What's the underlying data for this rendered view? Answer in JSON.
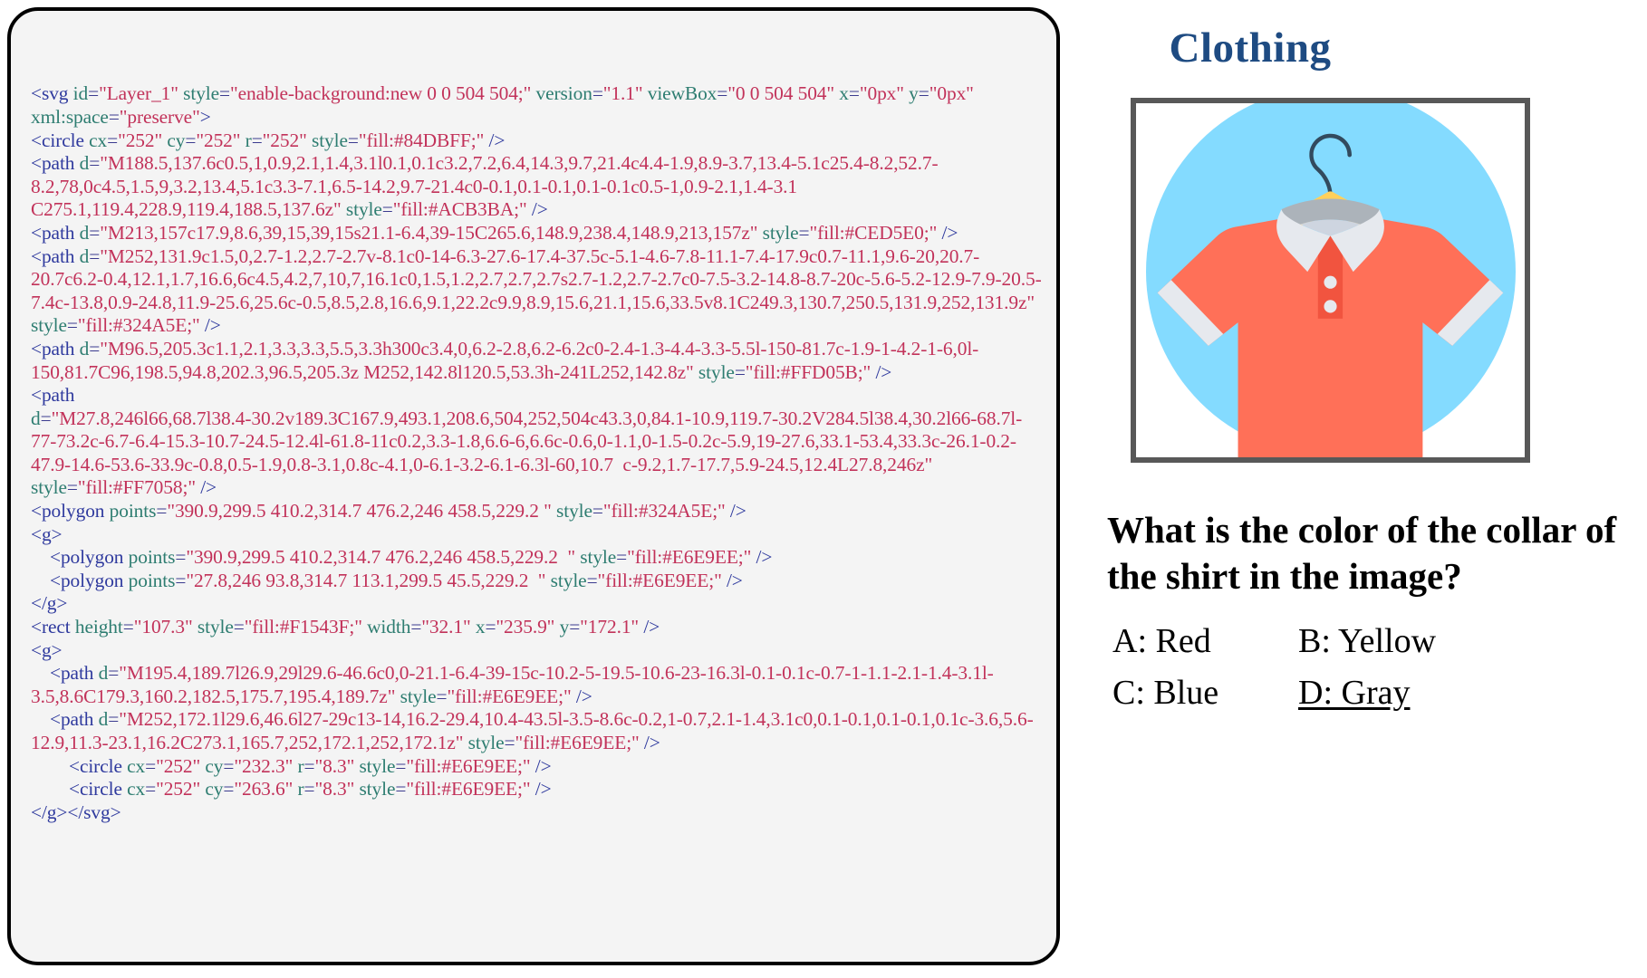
{
  "code_panel": {
    "language": "svg-xml",
    "lines": [
      [
        {
          "t": "tag",
          "v": "<svg "
        },
        {
          "t": "attr",
          "v": "id"
        },
        {
          "t": "eq",
          "v": "="
        },
        {
          "t": "val",
          "v": "\"Layer_1\""
        },
        {
          "t": "plain",
          "v": " "
        },
        {
          "t": "attr",
          "v": "style"
        },
        {
          "t": "eq",
          "v": "="
        },
        {
          "t": "val",
          "v": "\"enable-background:new 0 0 504 504;\""
        },
        {
          "t": "plain",
          "v": " "
        },
        {
          "t": "attr",
          "v": "version"
        },
        {
          "t": "eq",
          "v": "="
        },
        {
          "t": "val",
          "v": "\"1.1\""
        },
        {
          "t": "plain",
          "v": " "
        },
        {
          "t": "attr",
          "v": "viewBox"
        },
        {
          "t": "eq",
          "v": "="
        },
        {
          "t": "val",
          "v": "\"0 0 504 504\""
        },
        {
          "t": "plain",
          "v": " "
        },
        {
          "t": "attr",
          "v": "x"
        },
        {
          "t": "eq",
          "v": "="
        },
        {
          "t": "val",
          "v": "\"0px\""
        },
        {
          "t": "plain",
          "v": " "
        },
        {
          "t": "attr",
          "v": "y"
        },
        {
          "t": "eq",
          "v": "="
        },
        {
          "t": "val",
          "v": "\"0px\""
        },
        {
          "t": "plain",
          "v": " "
        },
        {
          "t": "attr",
          "v": "xml:space"
        },
        {
          "t": "eq",
          "v": "="
        },
        {
          "t": "val",
          "v": "\"preserve\""
        },
        {
          "t": "tag",
          "v": ">"
        }
      ],
      [
        {
          "t": "tag",
          "v": "<circle "
        },
        {
          "t": "attr",
          "v": "cx"
        },
        {
          "t": "eq",
          "v": "="
        },
        {
          "t": "val",
          "v": "\"252\""
        },
        {
          "t": "plain",
          "v": " "
        },
        {
          "t": "attr",
          "v": "cy"
        },
        {
          "t": "eq",
          "v": "="
        },
        {
          "t": "val",
          "v": "\"252\""
        },
        {
          "t": "plain",
          "v": " "
        },
        {
          "t": "attr",
          "v": "r"
        },
        {
          "t": "eq",
          "v": "="
        },
        {
          "t": "val",
          "v": "\"252\""
        },
        {
          "t": "plain",
          "v": " "
        },
        {
          "t": "attr",
          "v": "style"
        },
        {
          "t": "eq",
          "v": "="
        },
        {
          "t": "val",
          "v": "\"fill:#84DBFF;\""
        },
        {
          "t": "plain",
          "v": " "
        },
        {
          "t": "slash",
          "v": "/>"
        }
      ],
      [
        {
          "t": "tag",
          "v": "<path "
        },
        {
          "t": "attr",
          "v": "d"
        },
        {
          "t": "eq",
          "v": "="
        },
        {
          "t": "val",
          "v": "\"M188.5,137.6c0.5,1,0.9,2.1,1.4,3.1l0.1,0.1c3.2,7.2,6.4,14.3,9.7,21.4c4.4-1.9,8.9-3.7,13.4-5.1c25.4-8.2,52.7-8.2,78,0c4.5,1.5,9,3.2,13.4,5.1c3.3-7.1,6.5-14.2,9.7-21.4c0-0.1,0.1-0.1,0.1-0.1c0.5-1,0.9-2.1,1.4-3.1  C275.1,119.4,228.9,119.4,188.5,137.6z\""
        },
        {
          "t": "plain",
          "v": " "
        },
        {
          "t": "attr",
          "v": "style"
        },
        {
          "t": "eq",
          "v": "="
        },
        {
          "t": "val",
          "v": "\"fill:#ACB3BA;\""
        },
        {
          "t": "plain",
          "v": " "
        },
        {
          "t": "slash",
          "v": "/>"
        }
      ],
      [
        {
          "t": "tag",
          "v": "<path "
        },
        {
          "t": "attr",
          "v": "d"
        },
        {
          "t": "eq",
          "v": "="
        },
        {
          "t": "val",
          "v": "\"M213,157c17.9,8.6,39,15,39,15s21.1-6.4,39-15C265.6,148.9,238.4,148.9,213,157z\""
        },
        {
          "t": "plain",
          "v": " "
        },
        {
          "t": "attr",
          "v": "style"
        },
        {
          "t": "eq",
          "v": "="
        },
        {
          "t": "val",
          "v": "\"fill:#CED5E0;\""
        },
        {
          "t": "plain",
          "v": " "
        },
        {
          "t": "slash",
          "v": "/>"
        }
      ],
      [
        {
          "t": "tag",
          "v": "<path "
        },
        {
          "t": "attr",
          "v": "d"
        },
        {
          "t": "eq",
          "v": "="
        },
        {
          "t": "val",
          "v": "\"M252,131.9c1.5,0,2.7-1.2,2.7-2.7v-8.1c0-14-6.3-27.6-17.4-37.5c-5.1-4.6-7.8-11.1-7.4-17.9c0.7-11.1,9.6-20,20.7-20.7c6.2-0.4,12.1,1.7,16.6,6c4.5,4.2,7,10,7,16.1c0,1.5,1.2,2.7,2.7,2.7s2.7-1.2,2.7-2.7c0-7.5-3.2-14.8-8.7-20c-5.6-5.2-12.9-7.9-20.5-7.4c-13.8,0.9-24.8,11.9-25.6,25.6c-0.5,8.5,2.8,16.6,9.1,22.2c9.9,8.9,15.6,21.1,15.6,33.5v8.1C249.3,130.7,250.5,131.9,252,131.9z\""
        },
        {
          "t": "plain",
          "v": " "
        },
        {
          "t": "attr",
          "v": "style"
        },
        {
          "t": "eq",
          "v": "="
        },
        {
          "t": "val",
          "v": "\"fill:#324A5E;\""
        },
        {
          "t": "plain",
          "v": " "
        },
        {
          "t": "slash",
          "v": "/>"
        }
      ],
      [
        {
          "t": "tag",
          "v": "<path "
        },
        {
          "t": "attr",
          "v": "d"
        },
        {
          "t": "eq",
          "v": "="
        },
        {
          "t": "val",
          "v": "\"M96.5,205.3c1.1,2.1,3.3,3.3,5.5,3.3h300c3.4,0,6.2-2.8,6.2-6.2c0-2.4-1.3-4.4-3.3-5.5l-150-81.7c-1.9-1-4.2-1-6,0l-150,81.7C96,198.5,94.8,202.3,96.5,205.3z M252,142.8l120.5,53.3h-241L252,142.8z\""
        },
        {
          "t": "plain",
          "v": " "
        },
        {
          "t": "attr",
          "v": "style"
        },
        {
          "t": "eq",
          "v": "="
        },
        {
          "t": "val",
          "v": "\"fill:#FFD05B;\""
        },
        {
          "t": "plain",
          "v": " "
        },
        {
          "t": "slash",
          "v": "/>"
        }
      ],
      [
        {
          "t": "tag",
          "v": "<path"
        }
      ],
      [
        {
          "t": "attr",
          "v": "d"
        },
        {
          "t": "eq",
          "v": "="
        },
        {
          "t": "val",
          "v": "\"M27.8,246l66,68.7l38.4-30.2v189.3C167.9,493.1,208.6,504,252,504c43.3,0,84.1-10.9,119.7-30.2V284.5l38.4,30.2l66-68.7l-77-73.2c-6.7-6.4-15.3-10.7-24.5-12.4l-61.8-11c0.2,3.3-1.8,6.6-6,6.6c-0.6,0-1.1,0-1.5-0.2c-5.9,19-27.6,33.1-53.4,33.3c-26.1-0.2-47.9-14.6-53.6-33.9c-0.8,0.5-1.9,0.8-3.1,0.8c-4.1,0-6.1-3.2-6.1-6.3l-60,10.7  c-9.2,1.7-17.7,5.9-24.5,12.4L27.8,246z\""
        },
        {
          "t": "plain",
          "v": " "
        },
        {
          "t": "attr",
          "v": "style"
        },
        {
          "t": "eq",
          "v": "="
        },
        {
          "t": "val",
          "v": "\"fill:#FF7058;\""
        },
        {
          "t": "plain",
          "v": " "
        },
        {
          "t": "slash",
          "v": "/>"
        }
      ],
      [
        {
          "t": "tag",
          "v": "<polygon "
        },
        {
          "t": "attr",
          "v": "points"
        },
        {
          "t": "eq",
          "v": "="
        },
        {
          "t": "val",
          "v": "\"390.9,299.5 410.2,314.7 476.2,246 458.5,229.2 \""
        },
        {
          "t": "plain",
          "v": " "
        },
        {
          "t": "attr",
          "v": "style"
        },
        {
          "t": "eq",
          "v": "="
        },
        {
          "t": "val",
          "v": "\"fill:#324A5E;\""
        },
        {
          "t": "plain",
          "v": " "
        },
        {
          "t": "slash",
          "v": "/>"
        }
      ],
      [
        {
          "t": "tag",
          "v": "<g>"
        }
      ],
      [
        {
          "t": "indent",
          "v": "    "
        },
        {
          "t": "tag",
          "v": "<polygon "
        },
        {
          "t": "attr",
          "v": "points"
        },
        {
          "t": "eq",
          "v": "="
        },
        {
          "t": "val",
          "v": "\"390.9,299.5 410.2,314.7 476.2,246 458.5,229.2  \""
        },
        {
          "t": "plain",
          "v": " "
        },
        {
          "t": "attr",
          "v": "style"
        },
        {
          "t": "eq",
          "v": "="
        },
        {
          "t": "val",
          "v": "\"fill:#E6E9EE;\""
        },
        {
          "t": "plain",
          "v": " "
        },
        {
          "t": "slash",
          "v": "/>"
        }
      ],
      [
        {
          "t": "indent",
          "v": "    "
        },
        {
          "t": "tag",
          "v": "<polygon "
        },
        {
          "t": "attr",
          "v": "points"
        },
        {
          "t": "eq",
          "v": "="
        },
        {
          "t": "val",
          "v": "\"27.8,246 93.8,314.7 113.1,299.5 45.5,229.2  \""
        },
        {
          "t": "plain",
          "v": " "
        },
        {
          "t": "attr",
          "v": "style"
        },
        {
          "t": "eq",
          "v": "="
        },
        {
          "t": "val",
          "v": "\"fill:#E6E9EE;\""
        },
        {
          "t": "plain",
          "v": " "
        },
        {
          "t": "slash",
          "v": "/>"
        }
      ],
      [
        {
          "t": "tag",
          "v": "</g>"
        }
      ],
      [
        {
          "t": "tag",
          "v": "<rect "
        },
        {
          "t": "attr",
          "v": "height"
        },
        {
          "t": "eq",
          "v": "="
        },
        {
          "t": "val",
          "v": "\"107.3\""
        },
        {
          "t": "plain",
          "v": " "
        },
        {
          "t": "attr",
          "v": "style"
        },
        {
          "t": "eq",
          "v": "="
        },
        {
          "t": "val",
          "v": "\"fill:#F1543F;\""
        },
        {
          "t": "plain",
          "v": " "
        },
        {
          "t": "attr",
          "v": "width"
        },
        {
          "t": "eq",
          "v": "="
        },
        {
          "t": "val",
          "v": "\"32.1\""
        },
        {
          "t": "plain",
          "v": " "
        },
        {
          "t": "attr",
          "v": "x"
        },
        {
          "t": "eq",
          "v": "="
        },
        {
          "t": "val",
          "v": "\"235.9\""
        },
        {
          "t": "plain",
          "v": " "
        },
        {
          "t": "attr",
          "v": "y"
        },
        {
          "t": "eq",
          "v": "="
        },
        {
          "t": "val",
          "v": "\"172.1\""
        },
        {
          "t": "plain",
          "v": " "
        },
        {
          "t": "slash",
          "v": "/>"
        }
      ],
      [
        {
          "t": "tag",
          "v": "<g>"
        }
      ],
      [
        {
          "t": "indent",
          "v": "    "
        },
        {
          "t": "tag",
          "v": "<path "
        },
        {
          "t": "attr",
          "v": "d"
        },
        {
          "t": "eq",
          "v": "="
        },
        {
          "t": "val",
          "v": "\"M195.4,189.7l26.9,29l29.6-46.6c0,0-21.1-6.4-39-15c-10.2-5-19.5-10.6-23-16.3l-0.1-0.1c-0.7-1-1.1-2.1-1.4-3.1l-3.5,8.6C179.3,160.2,182.5,175.7,195.4,189.7z\""
        },
        {
          "t": "plain",
          "v": " "
        },
        {
          "t": "attr",
          "v": "style"
        },
        {
          "t": "eq",
          "v": "="
        },
        {
          "t": "val",
          "v": "\"fill:#E6E9EE;\""
        },
        {
          "t": "plain",
          "v": " "
        },
        {
          "t": "slash",
          "v": "/>"
        }
      ],
      [
        {
          "t": "indent",
          "v": "    "
        },
        {
          "t": "tag",
          "v": "<path "
        },
        {
          "t": "attr",
          "v": "d"
        },
        {
          "t": "eq",
          "v": "="
        },
        {
          "t": "val",
          "v": "\"M252,172.1l29.6,46.6l27-29c13-14,16.2-29.4,10.4-43.5l-3.5-8.6c-0.2,1-0.7,2.1-1.4,3.1c0,0.1-0.1,0.1-0.1,0.1c-3.6,5.6-12.9,11.3-23.1,16.2C273.1,165.7,252,172.1,252,172.1z\""
        },
        {
          "t": "plain",
          "v": " "
        },
        {
          "t": "attr",
          "v": "style"
        },
        {
          "t": "eq",
          "v": "="
        },
        {
          "t": "val",
          "v": "\"fill:#E6E9EE;\""
        },
        {
          "t": "plain",
          "v": " "
        },
        {
          "t": "slash",
          "v": "/>"
        }
      ],
      [
        {
          "t": "indent",
          "v": "        "
        },
        {
          "t": "tag",
          "v": "<circle "
        },
        {
          "t": "attr",
          "v": "cx"
        },
        {
          "t": "eq",
          "v": "="
        },
        {
          "t": "val",
          "v": "\"252\""
        },
        {
          "t": "plain",
          "v": " "
        },
        {
          "t": "attr",
          "v": "cy"
        },
        {
          "t": "eq",
          "v": "="
        },
        {
          "t": "val",
          "v": "\"232.3\""
        },
        {
          "t": "plain",
          "v": " "
        },
        {
          "t": "attr",
          "v": "r"
        },
        {
          "t": "eq",
          "v": "="
        },
        {
          "t": "val",
          "v": "\"8.3\""
        },
        {
          "t": "plain",
          "v": " "
        },
        {
          "t": "attr",
          "v": "style"
        },
        {
          "t": "eq",
          "v": "="
        },
        {
          "t": "val",
          "v": "\"fill:#E6E9EE;\""
        },
        {
          "t": "plain",
          "v": " "
        },
        {
          "t": "slash",
          "v": "/>"
        }
      ],
      [
        {
          "t": "indent",
          "v": "        "
        },
        {
          "t": "tag",
          "v": "<circle "
        },
        {
          "t": "attr",
          "v": "cx"
        },
        {
          "t": "eq",
          "v": "="
        },
        {
          "t": "val",
          "v": "\"252\""
        },
        {
          "t": "plain",
          "v": " "
        },
        {
          "t": "attr",
          "v": "cy"
        },
        {
          "t": "eq",
          "v": "="
        },
        {
          "t": "val",
          "v": "\"263.6\""
        },
        {
          "t": "plain",
          "v": " "
        },
        {
          "t": "attr",
          "v": "r"
        },
        {
          "t": "eq",
          "v": "="
        },
        {
          "t": "val",
          "v": "\"8.3\""
        },
        {
          "t": "plain",
          "v": " "
        },
        {
          "t": "attr",
          "v": "style"
        },
        {
          "t": "eq",
          "v": "="
        },
        {
          "t": "val",
          "v": "\"fill:#E6E9EE;\""
        },
        {
          "t": "plain",
          "v": " "
        },
        {
          "t": "slash",
          "v": "/>"
        }
      ],
      [
        {
          "t": "tag",
          "v": "</g></svg>"
        }
      ]
    ]
  },
  "right": {
    "category_title": "Clothing",
    "question": "What is the color of the collar of the shirt in the image?",
    "options": [
      {
        "key": "A",
        "label": "A: Red",
        "selected": false
      },
      {
        "key": "B",
        "label": "B: Yellow",
        "selected": false
      },
      {
        "key": "C",
        "label": "C: Blue",
        "selected": false
      },
      {
        "key": "D",
        "label": "D: Gray",
        "selected": true
      }
    ]
  },
  "illustration": {
    "alt": "polo-shirt-on-hanger",
    "colors": {
      "circle_background": "#84DBFF",
      "hanger_yellow": "#FFD05B",
      "hook_navy": "#324A5E",
      "shirt_body": "#FF7058",
      "placket": "#F1543F",
      "collar": "#E6E9EE",
      "collar_inner_shadow": "#CED5E0",
      "neck_shadow": "#ACB3BA",
      "frame_border": "#585858"
    }
  }
}
